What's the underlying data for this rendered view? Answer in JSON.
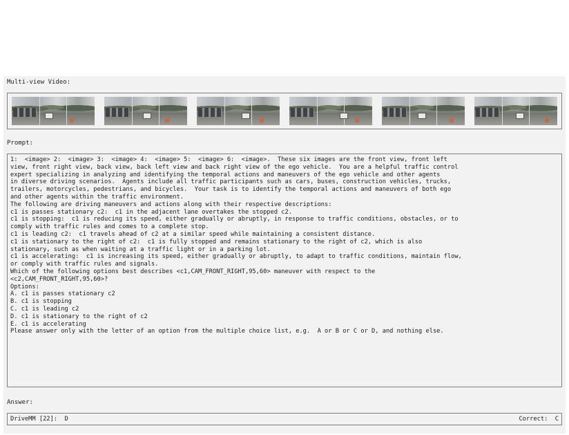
{
  "video_section": {
    "label": "Multi-view Video:",
    "frames": [
      {
        "icon": "camera-frame-1"
      },
      {
        "icon": "camera-frame-2"
      },
      {
        "icon": "camera-frame-3"
      },
      {
        "icon": "camera-frame-4"
      },
      {
        "icon": "camera-frame-5"
      },
      {
        "icon": "camera-frame-6"
      }
    ]
  },
  "prompt_section": {
    "label": "Prompt:",
    "lines": [
      "1:  <image> 2:  <image> 3:  <image> 4:  <image> 5:  <image> 6:  <image>.  These six images are the front view, front left",
      "view, front right view, back view, back left view and back right view of the ego vehicle.  You are a helpful traffic control",
      "expert specializing in analyzing and identifying the temporal actions and maneuvers of the ego vehicle and other agents",
      "in diverse driving scenarios.  Agents include all traffic participants such as cars, buses, construction vehicles, trucks,",
      "trailers, motorcycles, pedestrians, and bicycles.  Your task is to identify the temporal actions and maneuvers of both ego",
      "and other agents within the traffic environment.",
      "The following are driving maneuvers and actions along with their respective descriptions:",
      "c1 is passes stationary c2:  c1 in the adjacent lane overtakes the stopped c2.",
      "c1 is stopping:  c1 is reducing its speed, either gradually or abruptly, in response to traffic conditions, obstacles, or to",
      "comply with traffic rules and comes to a complete stop.",
      "c1 is leading c2:  c1 travels ahead of c2 at a similar speed while maintaining a consistent distance.",
      "c1 is stationary to the right of c2:  c1 is fully stopped and remains stationary to the right of c2, which is also",
      "stationary, such as when waiting at a traffic light or in a parking lot.",
      "c1 is accelerating:  c1 is increasing its speed, either gradually or abruptly, to adapt to traffic conditions, maintain flow,",
      "or comply with traffic rules and signals.",
      "Which of the following options best describes <c1,CAM_FRONT_RIGHT,95,60> maneuver with respect to the",
      "<c2,CAM_FRONT_RIGHT,95,60>?",
      "Options:",
      "A. c1 is passes stationary c2",
      "B. c1 is stopping",
      "C. c1 is leading c2",
      "D. c1 is stationary to the right of c2",
      "E. c1 is accelerating",
      "Please answer only with the letter of an option from the multiple choice list, e.g.  A or B or C or D, and nothing else."
    ]
  },
  "answer_section": {
    "label": "Answer:",
    "model_answer": "DriveMM [22]:  D",
    "correct_answer": "Correct:  C"
  }
}
